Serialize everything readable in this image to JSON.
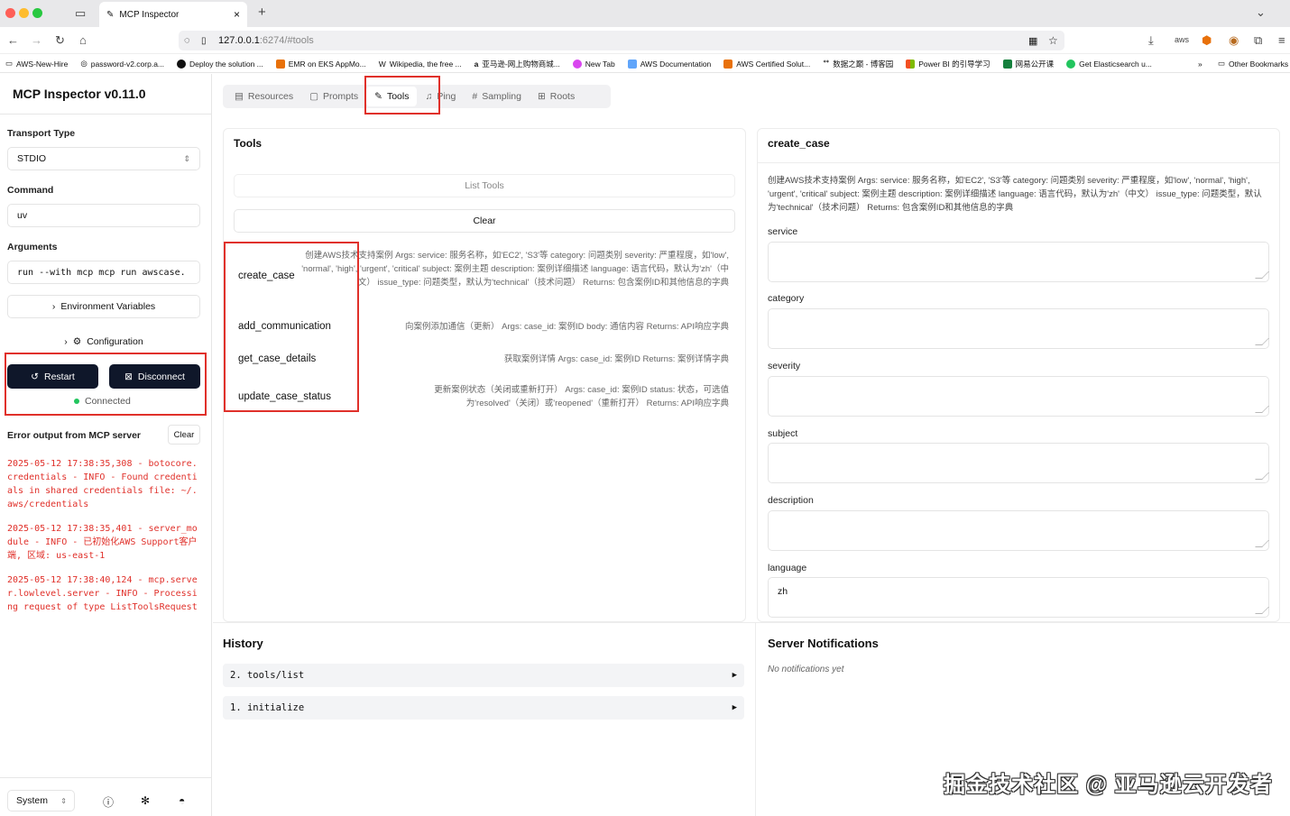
{
  "browser": {
    "tab_title": "MCP Inspector",
    "url_host": "127.0.0.1",
    "url_rest": ":6274/#tools",
    "bookmarks": [
      "AWS-New-Hire",
      "password-v2.corp.a...",
      "Deploy the solution ...",
      "EMR on EKS AppMo...",
      "Wikipedia, the free ...",
      "亚马逊-网上购物商城...",
      "New Tab",
      "AWS Documentation",
      "AWS Certified Solut...",
      "数据之巅 - 博客园",
      "Power BI 的引导学习",
      "网易公开课",
      "Get Elasticsearch u..."
    ],
    "other_bookmarks": "Other Bookmarks"
  },
  "sidebar": {
    "app_title": "MCP Inspector v0.11.0",
    "transport_label": "Transport Type",
    "transport_value": "STDIO",
    "command_label": "Command",
    "command_value": "uv",
    "arguments_label": "Arguments",
    "arguments_value": "run --with mcp mcp run awscase.",
    "env_vars_label": "Environment Variables",
    "configuration_label": "Configuration",
    "restart_label": "Restart",
    "disconnect_label": "Disconnect",
    "status_text": "Connected",
    "error_output_label": "Error output from MCP server",
    "clear_label": "Clear",
    "error_logs": [
      "2025-05-12 17:38:35,308 - botocore.credentials - INFO - Found credentials in shared credentials file: ~/.aws/credentials",
      "2025-05-12 17:38:35,401 - server_module - INFO - 已初始化AWS Support客户端, 区域: us-east-1",
      "2025-05-12 17:38:40,124 - mcp.server.lowlevel.server - INFO - Processing request of type ListToolsRequest"
    ],
    "theme_value": "System"
  },
  "main": {
    "tabs": [
      {
        "label": "Resources",
        "icon": "resources-icon"
      },
      {
        "label": "Prompts",
        "icon": "prompts-icon"
      },
      {
        "label": "Tools",
        "icon": "tools-icon"
      },
      {
        "label": "Ping",
        "icon": "ping-icon"
      },
      {
        "label": "Sampling",
        "icon": "hash-icon"
      },
      {
        "label": "Roots",
        "icon": "roots-icon"
      }
    ],
    "tools_title": "Tools",
    "list_tools_label": "List Tools",
    "clear_label": "Clear",
    "tools": [
      {
        "name": "create_case",
        "description": "创建AWS技术支持案例 Args: service: 服务名称，如'EC2', 'S3'等 category: 问题类别 severity: 严重程度，如'low', 'normal', 'high', 'urgent', 'critical' subject: 案例主题 description: 案例详细描述 language: 语言代码，默认为'zh'（中文） issue_type: 问题类型，默认为'technical'（技术问题） Returns: 包含案例ID和其他信息的字典"
      },
      {
        "name": "add_communication",
        "description": "向案例添加通信（更新） Args: case_id: 案例ID body: 通信内容 Returns: API响应字典"
      },
      {
        "name": "get_case_details",
        "description": "获取案例详情 Args: case_id: 案例ID Returns: 案例详情字典"
      },
      {
        "name": "update_case_status",
        "description": "更新案例状态（关闭或重新打开） Args: case_id: 案例ID status: 状态，可选值为'resolved'（关闭）或'reopened'（重新打开） Returns: API响应字典"
      }
    ],
    "detail": {
      "title": "create_case",
      "description": "创建AWS技术支持案例 Args: service: 服务名称，如'EC2', 'S3'等 category: 问题类别 severity: 严重程度，如'low', 'normal', 'high', 'urgent', 'critical' subject: 案例主题 description: 案例详细描述 language: 语言代码，默认为'zh'（中文） issue_type: 问题类型，默认为'technical'（技术问题） Returns: 包含案例ID和其他信息的字典",
      "fields": [
        {
          "label": "service",
          "value": ""
        },
        {
          "label": "category",
          "value": ""
        },
        {
          "label": "severity",
          "value": ""
        },
        {
          "label": "subject",
          "value": ""
        },
        {
          "label": "description",
          "value": ""
        },
        {
          "label": "language",
          "value": "zh"
        }
      ]
    },
    "history_title": "History",
    "history": [
      {
        "label": "2. tools/list"
      },
      {
        "label": "1. initialize"
      }
    ],
    "notifications_title": "Server Notifications",
    "notifications_empty": "No notifications yet",
    "watermark": "掘金技术社区 @ 亚马逊云开发者"
  }
}
